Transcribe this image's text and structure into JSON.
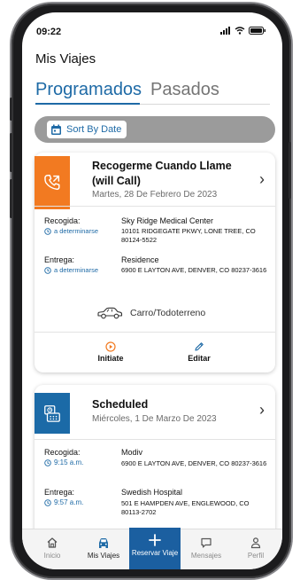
{
  "status_bar": {
    "time": "09:22"
  },
  "header": {
    "title": "Mis Viajes"
  },
  "tabs": [
    {
      "label": "Programados",
      "active": true
    },
    {
      "label": "Pasados",
      "active": false
    }
  ],
  "filter": {
    "sort_label": "Sort By Date"
  },
  "trips": [
    {
      "icon": "phone-callback-icon",
      "accent_color": "#f27a21",
      "title_line1": "Recogerme Cuando Llame",
      "title_line2": "(will Call)",
      "date": "Martes, 28 De Febrero De 2023",
      "pickup": {
        "label": "Recogida:",
        "time": "a determinarse",
        "name": "Sky Ridge Medical Center",
        "address": "10101 RIDGEGATE PKWY, LONE TREE, CO 80124-5522"
      },
      "dropoff": {
        "label": "Entrega:",
        "time": "a determinarse",
        "name": "Residence",
        "address": "6900 E LAYTON AVE, DENVER, CO 80237-3616"
      },
      "vehicle": "Carro/Todoterreno",
      "actions": [
        {
          "label": "Initiate",
          "icon": "play-circle-icon"
        },
        {
          "label": "Editar",
          "icon": "pencil-icon"
        }
      ]
    },
    {
      "icon": "scheduled-calendar-icon",
      "accent_color": "#1b6aa7",
      "title_line1": "Scheduled",
      "date": "Miércoles, 1 De Marzo De 2023",
      "pickup": {
        "label": "Recogida:",
        "time": "9:15 a.m.",
        "name": "Modiv",
        "address": "6900 E LAYTON AVE, DENVER, CO 80237-3616"
      },
      "dropoff": {
        "label": "Entrega:",
        "time": "9:57 a.m.",
        "name": "Swedish Hospital",
        "address": "501 E HAMPDEN AVE, ENGLEWOOD, CO 80113-2702"
      }
    }
  ],
  "bottom_nav": {
    "items": [
      {
        "label": "Inicio",
        "icon": "home-icon",
        "active": false
      },
      {
        "label": "Mis Viajes",
        "icon": "car-icon",
        "active": true
      },
      {
        "label": "Reservar Viaje",
        "icon": "plus-icon",
        "active": false
      },
      {
        "label": "Mensajes",
        "icon": "message-icon",
        "active": false
      },
      {
        "label": "Perfil",
        "icon": "person-icon",
        "active": false
      }
    ]
  },
  "colors": {
    "primary": "#1e6aa6",
    "accent_orange": "#f27a21",
    "nav_blue": "#1b5fa0"
  }
}
